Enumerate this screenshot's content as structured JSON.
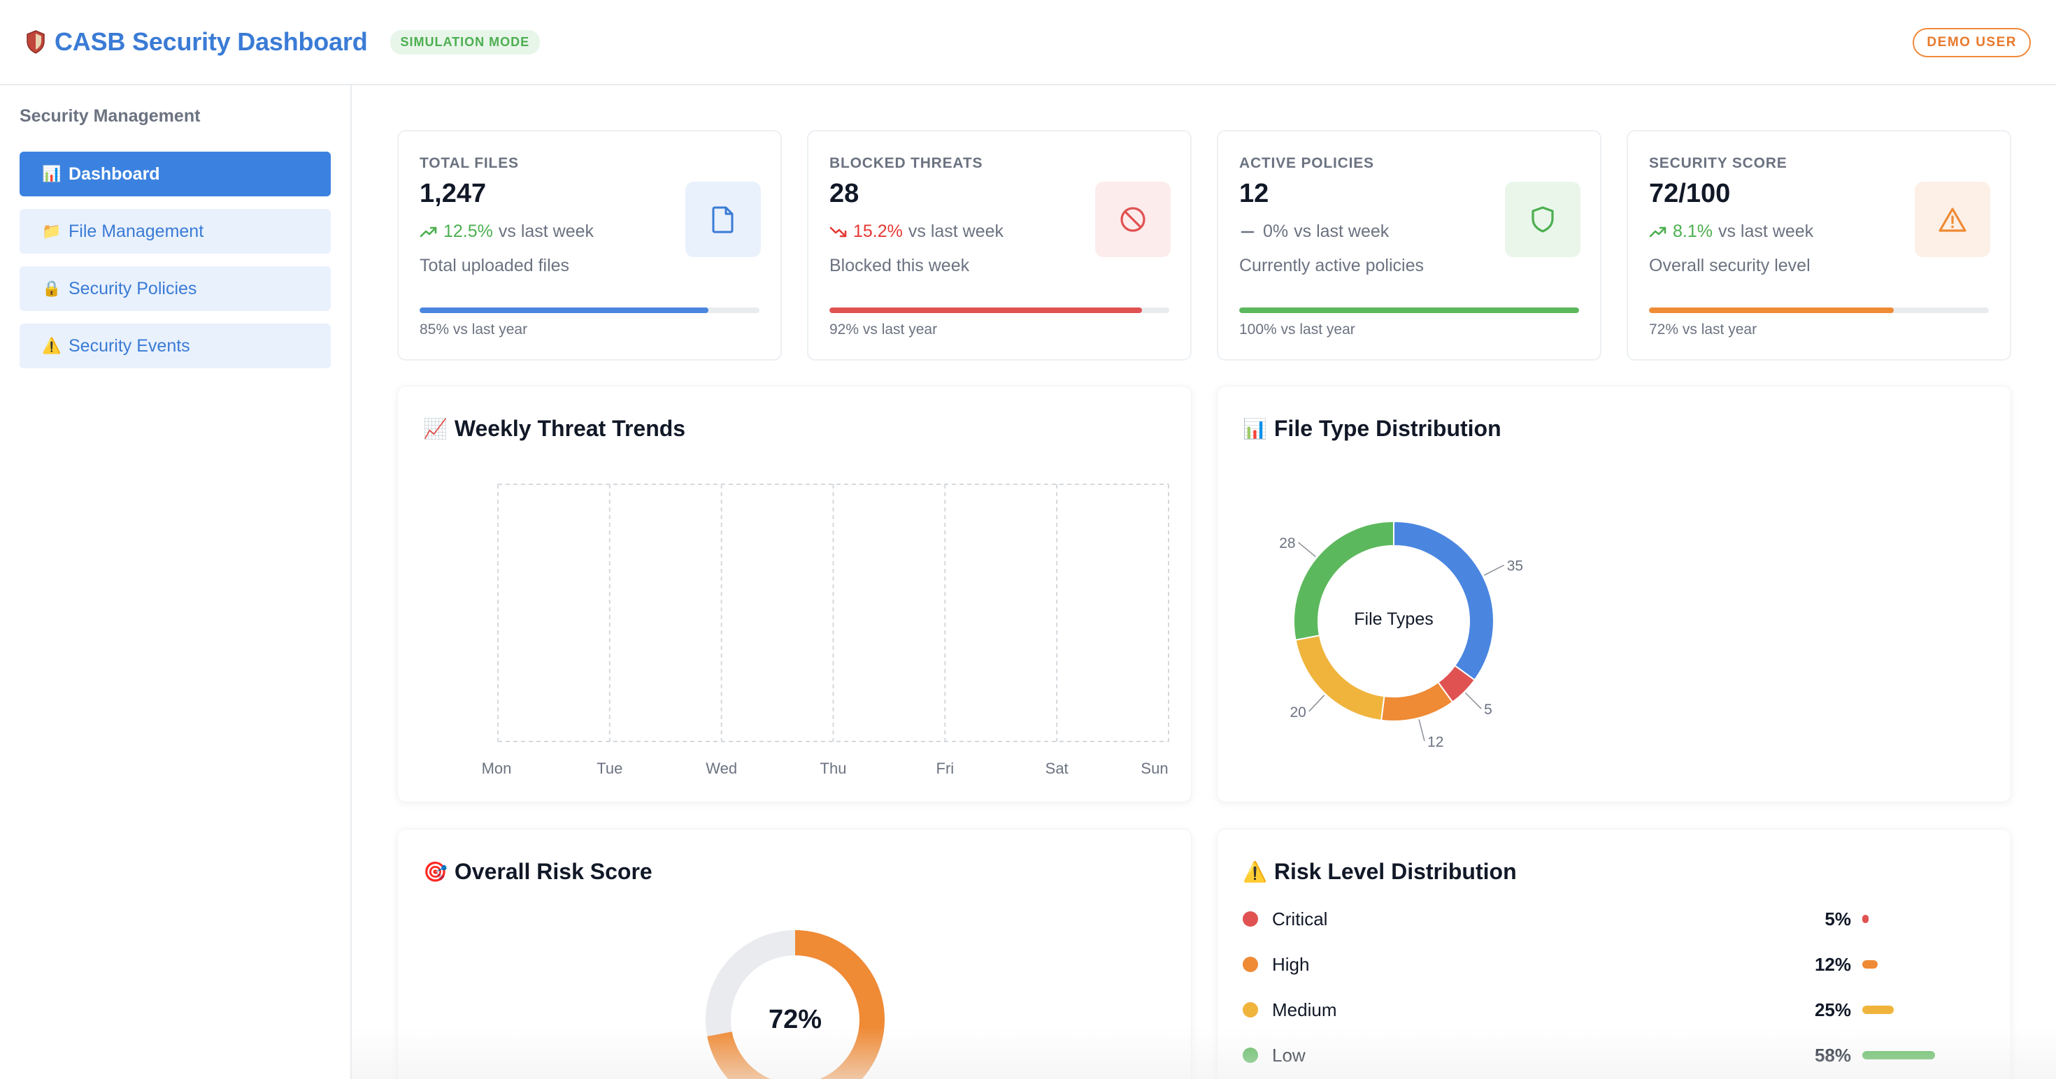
{
  "header": {
    "title": "CASB Security Dashboard",
    "mode_badge": "SIMULATION MODE",
    "user_badge": "DEMO USER",
    "logo_icon": "shield-icon"
  },
  "sidebar": {
    "title": "Security Management",
    "items": [
      {
        "icon": "📊",
        "label": "Dashboard",
        "active": true
      },
      {
        "icon": "📁",
        "label": "File Management",
        "active": false
      },
      {
        "icon": "🔒",
        "label": "Security Policies",
        "active": false
      },
      {
        "icon": "⚠️",
        "label": "Security Events",
        "active": false
      }
    ]
  },
  "stats": [
    {
      "label": "TOTAL FILES",
      "value": "1,247",
      "trend": "12.5%",
      "trend_dir": "up",
      "trend_suffix": "vs last week",
      "desc": "Total uploaded files",
      "progress": 0.85,
      "progress_color": "#4a86e0",
      "foot": "85% vs last year",
      "icon": "file-icon",
      "icon_bg": "#e9f1fd",
      "icon_color": "#3a7bd5"
    },
    {
      "label": "BLOCKED THREATS",
      "value": "28",
      "trend": "15.2%",
      "trend_dir": "down",
      "trend_suffix": "vs last week",
      "desc": "Blocked this week",
      "progress": 0.92,
      "progress_color": "#e05252",
      "foot": "92% vs last year",
      "icon": "block-icon",
      "icon_bg": "#fdecec",
      "icon_color": "#e05252"
    },
    {
      "label": "ACTIVE POLICIES",
      "value": "12",
      "trend": "0%",
      "trend_dir": "flat",
      "trend_suffix": "vs last week",
      "desc": "Currently active policies",
      "progress": 1.0,
      "progress_color": "#5cb85c",
      "foot": "100% vs last year",
      "icon": "shield-check-icon",
      "icon_bg": "#eaf6ea",
      "icon_color": "#4caf50"
    },
    {
      "label": "SECURITY SCORE",
      "value": "72/100",
      "trend": "8.1%",
      "trend_dir": "up",
      "trend_suffix": "vs last week",
      "desc": "Overall security level",
      "progress": 0.72,
      "progress_color": "#ef8a35",
      "foot": "72% vs last year",
      "icon": "warning-icon",
      "icon_bg": "#fdf0e6",
      "icon_color": "#ef8a35"
    }
  ],
  "threat_trends": {
    "title": "Weekly Threat Trends",
    "icon": "📈",
    "days": [
      "Mon",
      "Tue",
      "Wed",
      "Thu",
      "Fri",
      "Sat",
      "Sun"
    ]
  },
  "file_types": {
    "title": "File Type Distribution",
    "icon": "📊",
    "center_label": "File Types",
    "slices": [
      {
        "value": 35,
        "color": "#4a86e0"
      },
      {
        "value": 5,
        "color": "#e05252"
      },
      {
        "value": 12,
        "color": "#ef8a35"
      },
      {
        "value": 20,
        "color": "#f0b43c"
      },
      {
        "value": 28,
        "color": "#5cb85c"
      }
    ]
  },
  "risk_score": {
    "title": "Overall Risk Score",
    "icon": "🎯",
    "value_text": "72%",
    "value": 0.72,
    "color": "#ef8a35",
    "track_color": "#e9ebee"
  },
  "risk_levels": {
    "title": "Risk Level Distribution",
    "icon": "⚠️",
    "items": [
      {
        "name": "Critical",
        "pct": "5%",
        "value": 5,
        "color": "#e05252"
      },
      {
        "name": "High",
        "pct": "12%",
        "value": 12,
        "color": "#ef8a35"
      },
      {
        "name": "Medium",
        "pct": "25%",
        "value": 25,
        "color": "#f0b43c"
      },
      {
        "name": "Low",
        "pct": "58%",
        "value": 58,
        "color": "#5cb85c"
      }
    ]
  }
}
